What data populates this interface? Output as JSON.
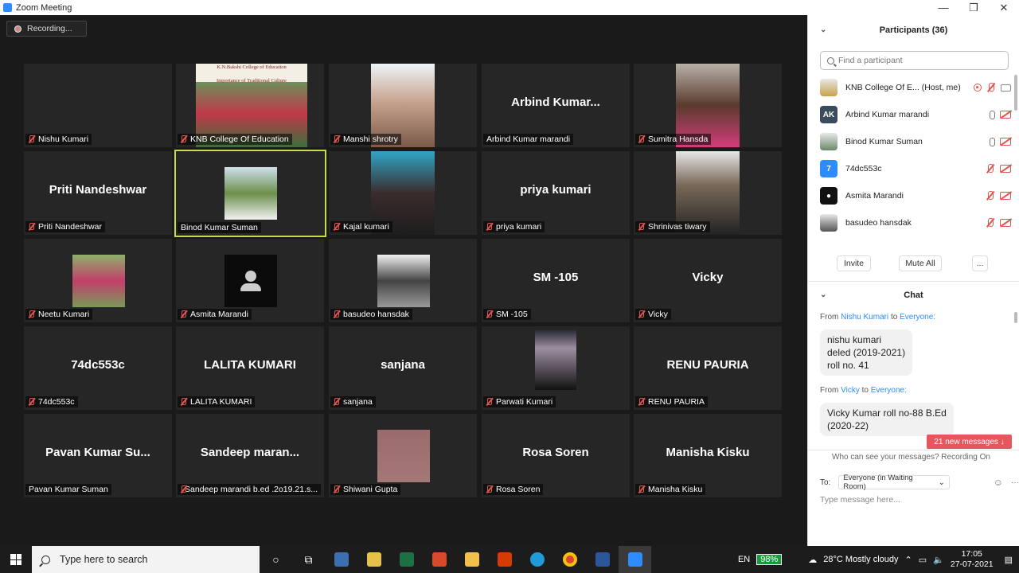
{
  "window": {
    "title": "Zoom Meeting",
    "controls": [
      "—",
      "❐",
      "✕"
    ]
  },
  "recording": {
    "label": "Recording..."
  },
  "tiles": [
    {
      "name": "Nishu Kumari",
      "big": "",
      "muted": true
    },
    {
      "name": "KNB College Of Education",
      "big": "",
      "muted": true
    },
    {
      "name": "Manshi shrotry",
      "big": "",
      "muted": true
    },
    {
      "name": "Arbind Kumar marandi",
      "big": "Arbind  Kumar...",
      "muted": false
    },
    {
      "name": "Sumitra Hansda",
      "big": "",
      "muted": true
    },
    {
      "name": "Priti Nandeshwar",
      "big": "Priti Nandeshwar",
      "muted": true
    },
    {
      "name": "Binod Kumar Suman",
      "big": "",
      "muted": false
    },
    {
      "name": "Kajal kumari",
      "big": "",
      "muted": true
    },
    {
      "name": "priya kumari",
      "big": "priya kumari",
      "muted": true
    },
    {
      "name": "Shrinivas tiwary",
      "big": "",
      "muted": true
    },
    {
      "name": "Neetu Kumari",
      "big": "",
      "muted": true
    },
    {
      "name": "Asmita Marandi",
      "big": "",
      "muted": true
    },
    {
      "name": "basudeo hansdak",
      "big": "",
      "muted": true
    },
    {
      "name": "SM -105",
      "big": "SM -105",
      "muted": true
    },
    {
      "name": "Vicky",
      "big": "Vicky",
      "muted": true
    },
    {
      "name": "74dc553c",
      "big": "74dc553c",
      "muted": true
    },
    {
      "name": "LALITA KUMARI",
      "big": "LALITA KUMARI",
      "muted": true
    },
    {
      "name": "sanjana",
      "big": "sanjana",
      "muted": true
    },
    {
      "name": "Parwati Kumari",
      "big": "",
      "muted": true
    },
    {
      "name": "RENU PAURIA",
      "big": "RENU PAURIA",
      "muted": true
    },
    {
      "name": "Pavan Kumar Suman",
      "big": "Pavan Kumar Su...",
      "muted": false
    },
    {
      "name": "Sandeep marandi  b.ed .2o19.21.s...",
      "big": "Sandeep  maran...",
      "muted": true
    },
    {
      "name": "Shiwani Gupta",
      "big": "",
      "muted": true
    },
    {
      "name": "Rosa Soren",
      "big": "Rosa Soren",
      "muted": true
    },
    {
      "name": "Manisha Kisku",
      "big": "Manisha Kisku",
      "muted": true
    }
  ],
  "slide": {
    "line1": "K.N.Bakshi College of Education",
    "line2": "Importance of Traditional Culture"
  },
  "participants": {
    "title": "Participants (36)",
    "search_placeholder": "Find a participant",
    "list": [
      {
        "name": "KNB College Of E...",
        "role": "(Host, me)",
        "avatar": "img",
        "color": "#c8a24a"
      },
      {
        "name": "Arbind Kumar marandi",
        "role": "",
        "avatar": "AK",
        "color": "#3b4a5c"
      },
      {
        "name": "Binod Kumar Suman",
        "role": "",
        "avatar": "img",
        "color": "#6a8a6a"
      },
      {
        "name": "74dc553c",
        "role": "",
        "avatar": "7",
        "color": "#2d8cff"
      },
      {
        "name": "Asmita Marandi",
        "role": "",
        "avatar": "person",
        "color": "#111111"
      },
      {
        "name": "basudeo hansdak",
        "role": "",
        "avatar": "img",
        "color": "#555555"
      }
    ],
    "invite": "Invite",
    "mute_all": "Mute All",
    "more": "..."
  },
  "chat": {
    "title": "Chat",
    "messages": [
      {
        "from": "Nishu Kumari",
        "to": "Everyone:",
        "lines": [
          "nishu kumari",
          "deled (2019-2021)",
          "roll no. 41"
        ]
      },
      {
        "from": "Vicky",
        "to": "Everyone:",
        "lines": [
          "Vicky Kumar roll no-88 B.Ed",
          "(2020-22)"
        ]
      }
    ],
    "from_word": "From",
    "to_word": "to",
    "new_messages": "21 new messages ↓",
    "who_can_see": "Who can see your messages? Recording On",
    "to_label": "To:",
    "to_value": "Everyone (in Waiting Room)",
    "input_placeholder": "Type message here..."
  },
  "taskbar": {
    "search_placeholder": "Type here to search",
    "lang": "EN",
    "battery": "98%",
    "weather": "28°C  Mostly cloudy",
    "time": "17:05",
    "date": "27-07-2021"
  }
}
